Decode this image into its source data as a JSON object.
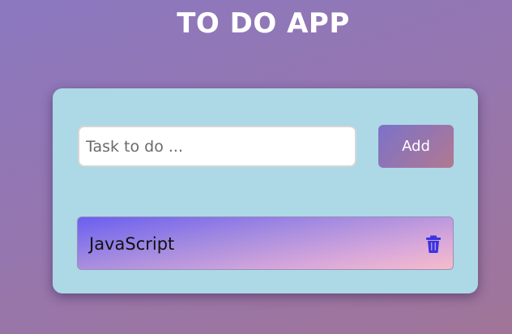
{
  "app": {
    "title": "TO DO APP"
  },
  "form": {
    "input_value": "",
    "input_placeholder": "Task to do ...",
    "add_label": "Add"
  },
  "todos": [
    {
      "text": "JavaScript",
      "icon": "trash-icon"
    }
  ],
  "colors": {
    "card_bg": "#add8e5",
    "delete_icon": "#3b33e0",
    "title_text": "#ffffff"
  }
}
